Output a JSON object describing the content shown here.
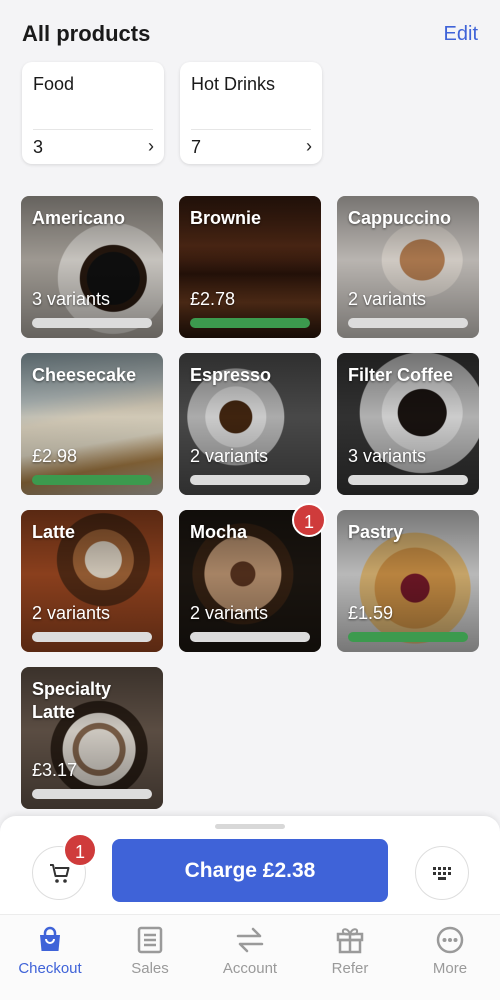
{
  "header": {
    "title": "All products",
    "edit_label": "Edit"
  },
  "categories": [
    {
      "name": "Food",
      "count": "3"
    },
    {
      "name": "Hot Drinks",
      "count": "7"
    }
  ],
  "products": [
    {
      "name": "Americano",
      "info": "3 variants",
      "bar": "grey"
    },
    {
      "name": "Brownie",
      "info": "£2.78",
      "bar": "green"
    },
    {
      "name": "Cappuccino",
      "info": "2 variants",
      "bar": "grey"
    },
    {
      "name": "Cheesecake",
      "info": "£2.98",
      "bar": "green"
    },
    {
      "name": "Espresso",
      "info": "2 variants",
      "bar": "grey"
    },
    {
      "name": "Filter Coffee",
      "info": "3 variants",
      "bar": "grey"
    },
    {
      "name": "Latte",
      "info": "2 variants",
      "bar": "grey"
    },
    {
      "name": "Mocha",
      "info": "2 variants",
      "bar": "grey",
      "badge": "1"
    },
    {
      "name": "Pastry",
      "info": "£1.59",
      "bar": "green"
    },
    {
      "name": "Specialty Latte",
      "info": "£3.17",
      "bar": "grey"
    }
  ],
  "cart": {
    "badge": "1"
  },
  "charge": {
    "label": "Charge £2.38"
  },
  "tabs": [
    {
      "label": "Checkout",
      "icon": "bag-icon",
      "active": true
    },
    {
      "label": "Sales",
      "icon": "receipt-icon"
    },
    {
      "label": "Account",
      "icon": "transfer-icon"
    },
    {
      "label": "Refer",
      "icon": "gift-icon"
    },
    {
      "label": "More",
      "icon": "more-icon"
    }
  ],
  "colors": {
    "accent": "#3f63d8",
    "badge": "#cf3b3b",
    "stock_green": "#3c9a4e",
    "stock_grey": "#dcdcdc"
  }
}
